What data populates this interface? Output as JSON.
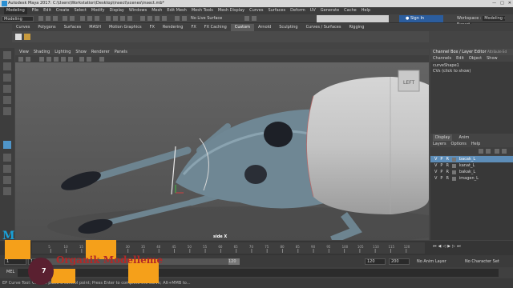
{
  "titlebar": {
    "title": "Autodesk Maya 2017: C:\\Users\\Workstation\\Desktop\\insect\\scenes\\insect.mb*",
    "controls": [
      "—",
      "□",
      "✕"
    ]
  },
  "menubar": {
    "items": [
      "Modeling",
      "File",
      "Edit",
      "Create",
      "Select",
      "Modify",
      "Display",
      "Windows",
      "Mesh",
      "Edit Mesh",
      "Mesh Tools",
      "Mesh Display",
      "Curves",
      "Surfaces",
      "Deform",
      "UV",
      "Generate",
      "Cache",
      "Help"
    ]
  },
  "statusline": {
    "mode": "Modeling",
    "live_surface": "No Live Surface",
    "sign_in": "Sign In",
    "workspace_label": "Workspace :",
    "workspace_value": "Modeling - Expert"
  },
  "shelf": {
    "tabs": [
      "Curves",
      "Polygons",
      "Surfaces",
      "MASH",
      "Motion Graphics",
      "FX",
      "Rendering",
      "FX",
      "FX Caching",
      "Custom",
      "Arnold",
      "Sculpting",
      "Curves / Surfaces",
      "Rigging"
    ],
    "active_index": 9
  },
  "viewport": {
    "menus": [
      "View",
      "Shading",
      "Lighting",
      "Show",
      "Renderer",
      "Panels"
    ],
    "camera_label": "side X",
    "cube_label": "LEFT"
  },
  "channelbox": {
    "title": "Channel Box / Layer Editor",
    "side_label": "Attribute Ed",
    "menus": [
      "Channels",
      "Edit",
      "Object",
      "Show"
    ],
    "shape_name": "curveShape1",
    "cvs": "CVs (click to show)",
    "layer_tabs": [
      "Display",
      "Anim"
    ],
    "layer_menus": [
      "Layers",
      "Options",
      "Help"
    ],
    "layers": [
      {
        "v": "V",
        "p": "P",
        "r": "R",
        "name": "bacak_L",
        "selected": true
      },
      {
        "v": "V",
        "p": "P",
        "r": "R",
        "name": "kanat_L",
        "selected": false
      },
      {
        "v": "V",
        "p": "P",
        "r": "R",
        "name": "bakak_L",
        "selected": false
      },
      {
        "v": "V",
        "p": "P",
        "r": "R",
        "name": "imagen_L",
        "selected": false
      }
    ]
  },
  "timeslider": {
    "ticks": [
      "5",
      "10",
      "15",
      "20",
      "25",
      "30",
      "35",
      "40",
      "45",
      "50",
      "55",
      "60",
      "65",
      "70",
      "75",
      "80",
      "85",
      "90",
      "95",
      "100",
      "105",
      "110",
      "115",
      "120"
    ],
    "current_frame": "1"
  },
  "rangeslider": {
    "start": "1",
    "start_inner": "1",
    "end_inner": "120",
    "end": "120",
    "end_outer": "200",
    "anim_layer": "No Anim Layer",
    "char_set": "No Character Set"
  },
  "commandline": {
    "label": "MEL"
  },
  "helpline": {
    "text": "EP Curve Tool: Click to place a control point; Press Enter to complete the curve; Alt+MMB to..."
  },
  "overlay": {
    "text": "Organik Modelleme",
    "timer": "7"
  },
  "colors": {
    "accent": "#4f95c9",
    "orange": "#f5a01a",
    "overlay_text": "#b22828"
  }
}
